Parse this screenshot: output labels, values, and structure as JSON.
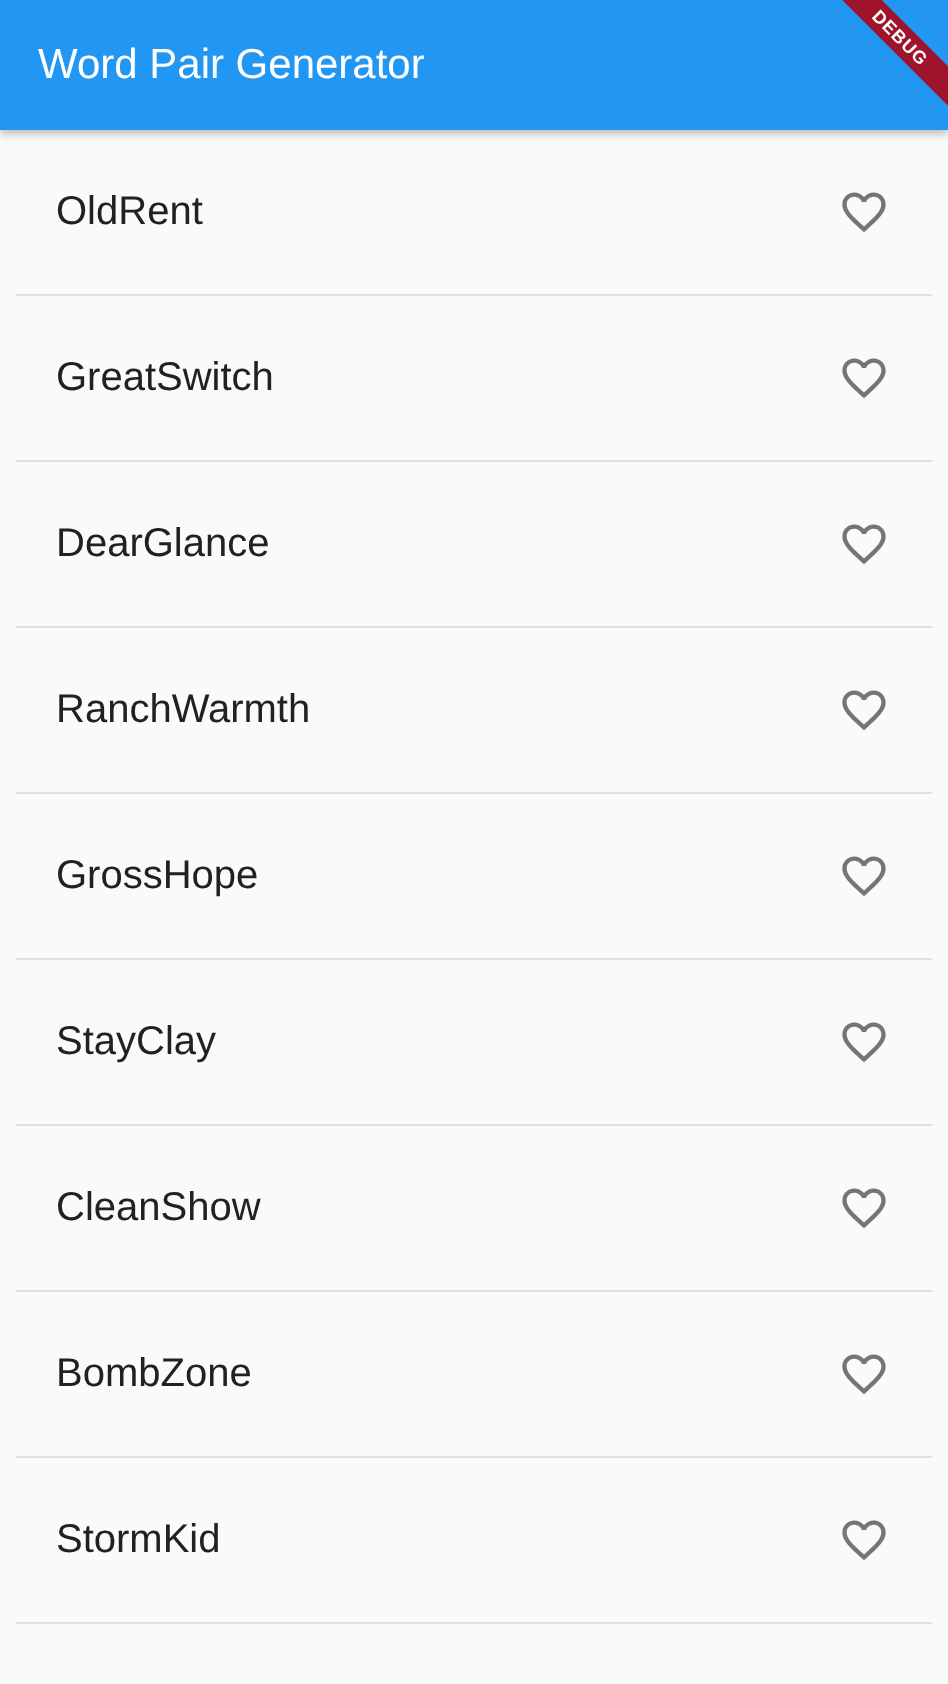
{
  "app_bar": {
    "title": "Word Pair Generator",
    "debug_banner": "DEBUG"
  },
  "pairs": [
    {
      "text": "OldRent",
      "saved": false
    },
    {
      "text": "GreatSwitch",
      "saved": false
    },
    {
      "text": "DearGlance",
      "saved": false
    },
    {
      "text": "RanchWarmth",
      "saved": false
    },
    {
      "text": "GrossHope",
      "saved": false
    },
    {
      "text": "StayClay",
      "saved": false
    },
    {
      "text": "CleanShow",
      "saved": false
    },
    {
      "text": "BombZone",
      "saved": false
    },
    {
      "text": "StormKid",
      "saved": false
    }
  ]
}
